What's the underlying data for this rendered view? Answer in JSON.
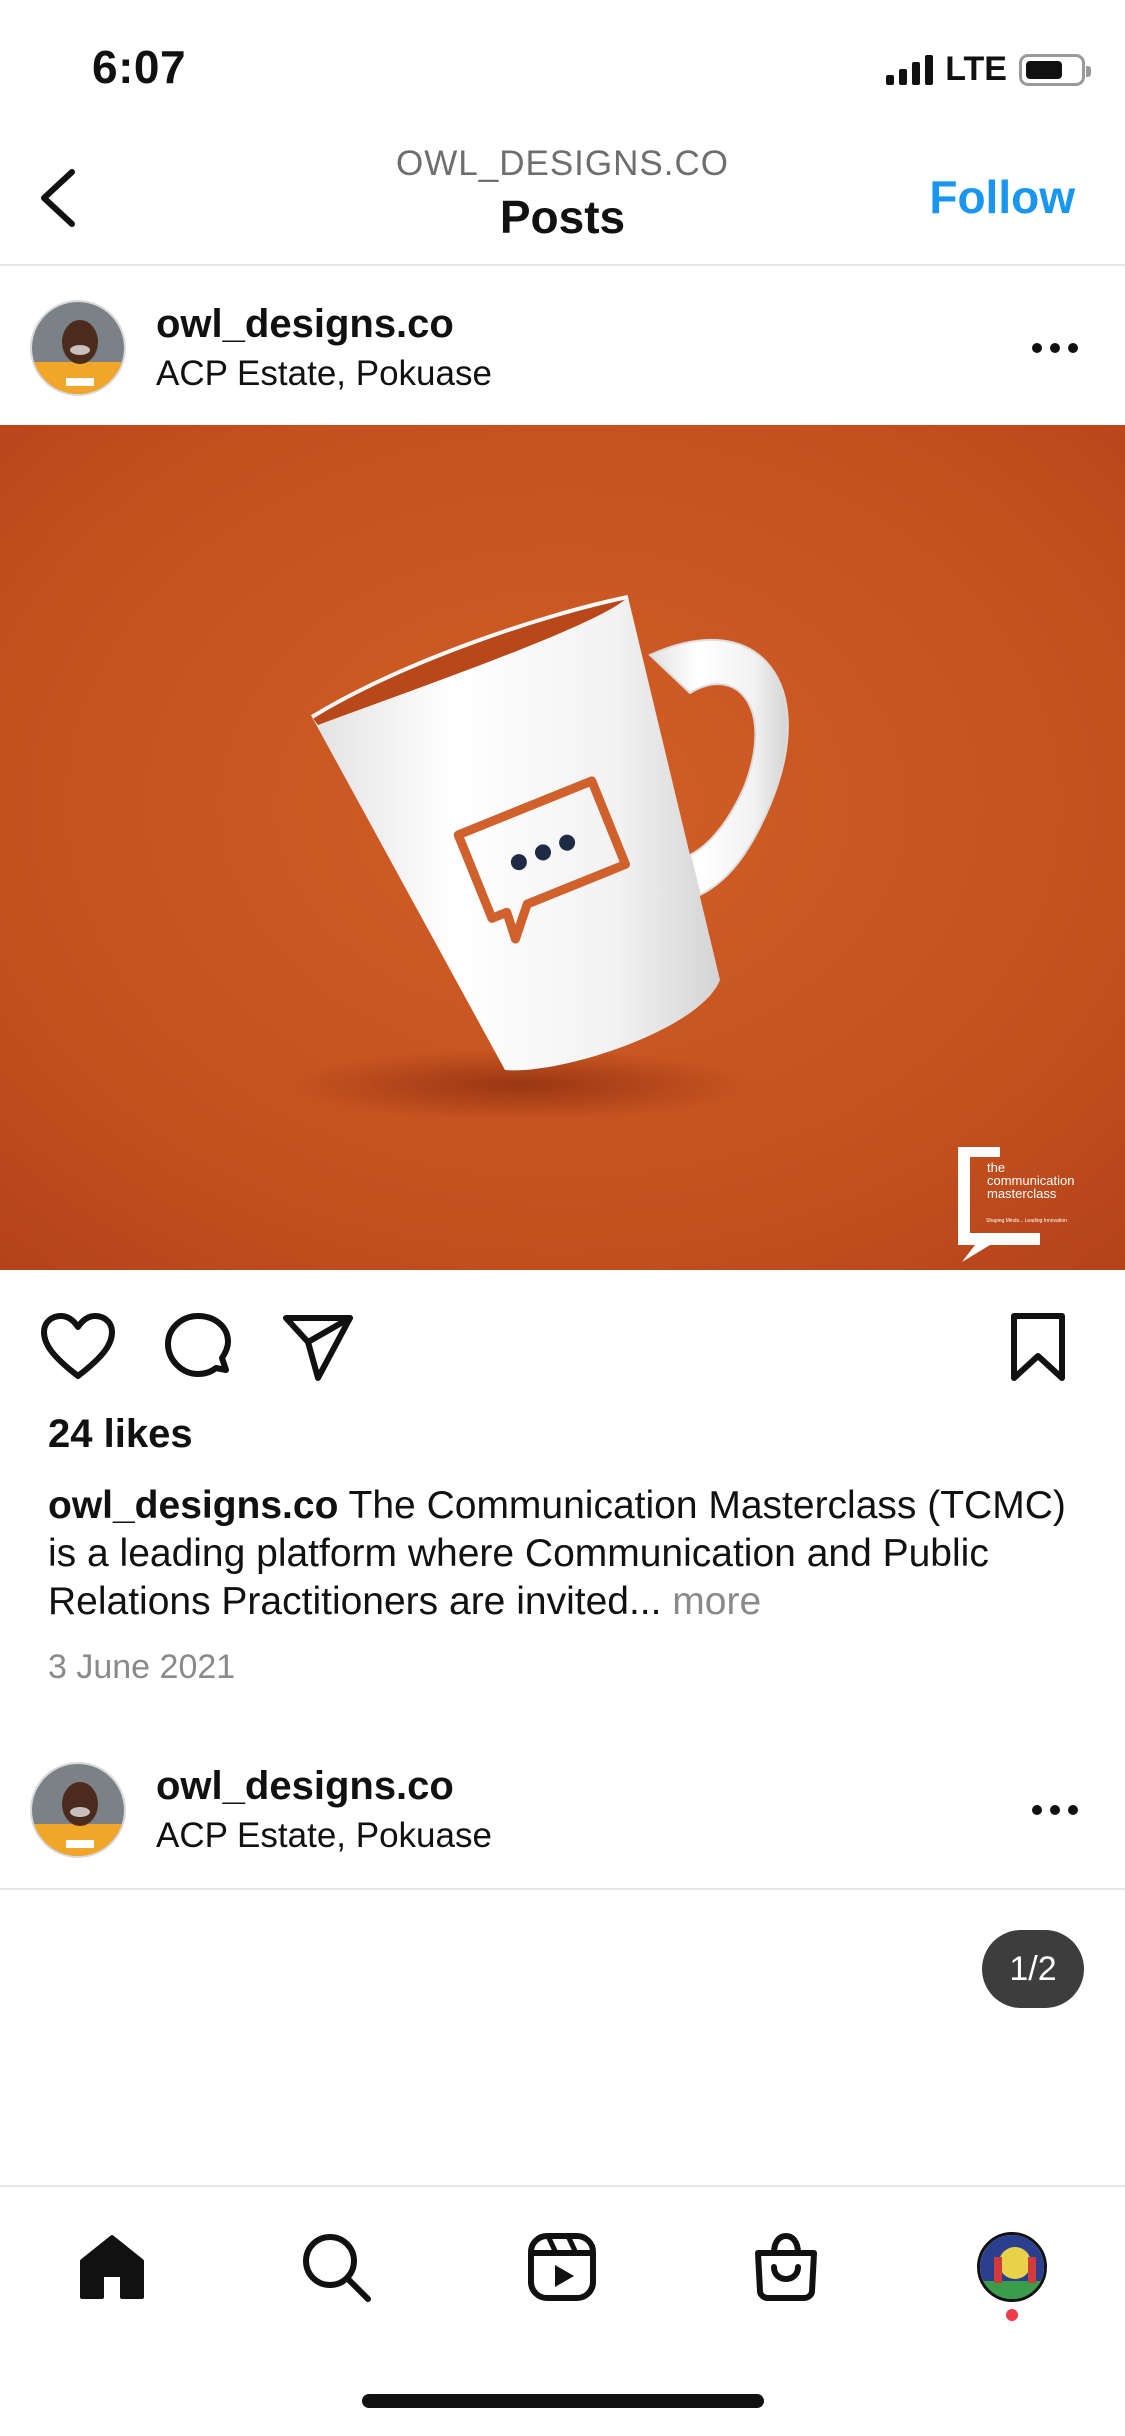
{
  "status_bar": {
    "time": "6:07",
    "network": "LTE"
  },
  "header": {
    "subtitle": "OWL_DESIGNS.CO",
    "title": "Posts",
    "follow_label": "Follow",
    "follow_color": "#1A96F0"
  },
  "post": {
    "username": "owl_designs.co",
    "location": "ACP Estate, Pokuase",
    "image": {
      "background_color": "#C8521F",
      "brand_logo_text": [
        "the",
        "communication",
        "masterclass"
      ],
      "brand_logo_tagline": "Shaping Minds... Leading Innovation"
    },
    "likes": "24 likes",
    "caption_user": "owl_designs.co",
    "caption_text": "The Communication Masterclass (TCMC) is a leading platform where Communication and Public Relations Practitioners are invited...",
    "caption_more": "more",
    "date": "3 June 2021"
  },
  "next_post": {
    "username": "owl_designs.co",
    "location": "ACP Estate, Pokuase",
    "page_counter": "1/2"
  },
  "tab_bar": {
    "items": [
      "home-icon",
      "search-icon",
      "reels-icon",
      "shop-icon",
      "profile-avatar"
    ],
    "notification_dot_color": "#EE3A4B"
  }
}
